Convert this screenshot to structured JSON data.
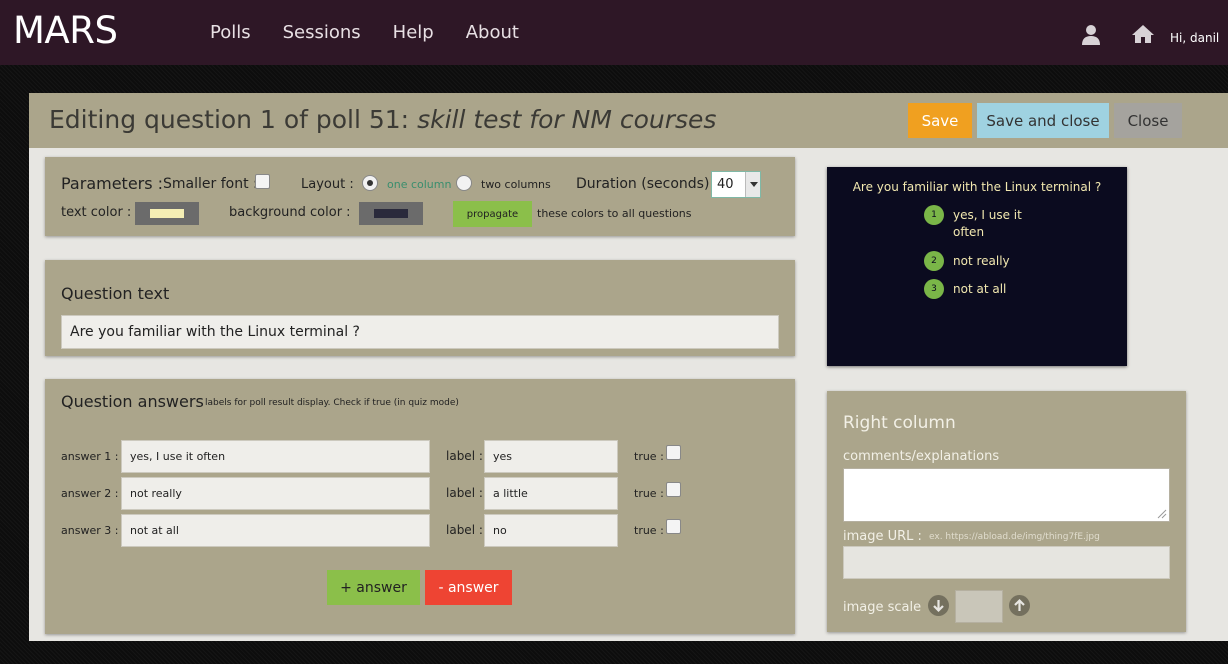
{
  "nav": {
    "brand": "MARS",
    "links": [
      "Polls",
      "Sessions",
      "Help",
      "About"
    ],
    "greeting": "Hi, danil"
  },
  "header": {
    "title_prefix": "Editing question 1 of poll 51: ",
    "poll_name": "skill test for NM courses",
    "save": "Save",
    "save_close": "Save and close",
    "close": "Close"
  },
  "params": {
    "label": "Parameters :",
    "smaller_font": "Smaller font :",
    "smaller_font_checked": false,
    "layout": "Layout :",
    "one_column": "one column",
    "two_columns": "two columns",
    "layout_selected": "one column",
    "duration_label": "Duration (seconds) :",
    "duration": "40",
    "text_color_label": "text color :",
    "text_color": "#f4eeb4",
    "bg_color_label": "background color :",
    "bg_color": "#2a2a3c",
    "propagate": "propagate",
    "propagate_suffix": "these colors to all questions"
  },
  "question": {
    "heading": "Question text",
    "text": "Are you familiar with the Linux terminal ?"
  },
  "answers": {
    "heading": "Question answers",
    "hint": "labels for poll result display. Check if true (in quiz mode)",
    "label_word": "label :",
    "true_word": "true :",
    "items": [
      {
        "prefix": "answer 1 :",
        "text": "yes, I use it often",
        "label": "yes",
        "is_true": false
      },
      {
        "prefix": "answer 2 :",
        "text": "not really",
        "label": "a little",
        "is_true": false
      },
      {
        "prefix": "answer 3 :",
        "text": "not at all",
        "label": "no",
        "is_true": false
      }
    ],
    "add": "+ answer",
    "remove": "- answer"
  },
  "preview": {
    "question": "Are you familiar with the Linux terminal ?",
    "answers": [
      {
        "num": "1",
        "text": "yes, I use it often"
      },
      {
        "num": "2",
        "text": "not really"
      },
      {
        "num": "3",
        "text": "not at all"
      }
    ]
  },
  "right_column": {
    "heading": "Right column",
    "comments_label": "comments/explanations",
    "comments": "",
    "image_url_label": "image URL :",
    "image_url_hint": "ex. https://abload.de/img/thing7fE.jpg",
    "image_url": "",
    "image_scale_label": "image scale",
    "image_scale": ""
  },
  "colors": {
    "nav_bg": "#2e1726",
    "panel": "#aba58b",
    "save": "#f0a020",
    "save_close": "#9fd2e1",
    "green": "#8bbf4a",
    "red": "#ee4433"
  }
}
